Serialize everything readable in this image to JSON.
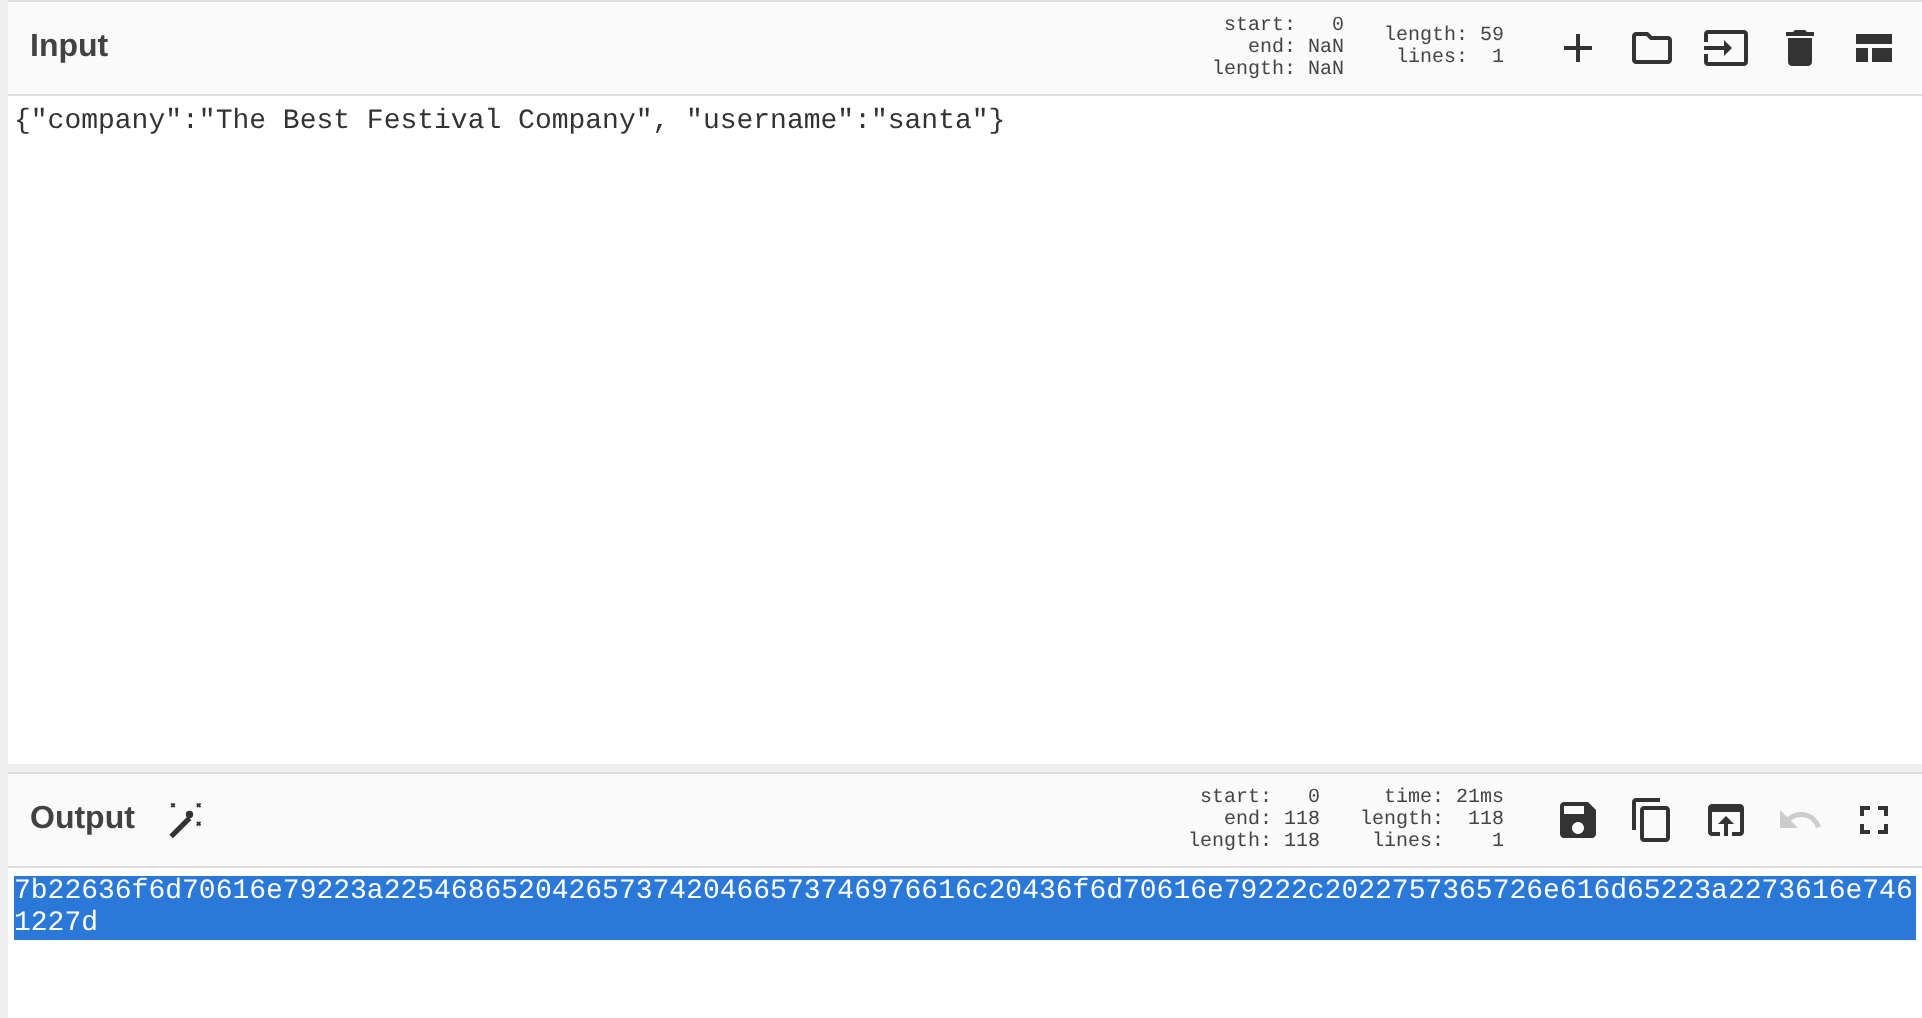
{
  "input": {
    "title": "Input",
    "stats": [
      {
        "label": "start:",
        "value": "0"
      },
      {
        "label": "end:",
        "value": "NaN"
      },
      {
        "label": "length:",
        "value": "NaN"
      }
    ],
    "stats_2": [
      {
        "label": "length:",
        "value": "59"
      },
      {
        "label": "lines:",
        "value": "1"
      }
    ],
    "tools": [
      {
        "kind": "add",
        "disabled": false
      },
      {
        "kind": "folder",
        "disabled": false
      },
      {
        "kind": "import",
        "disabled": false
      },
      {
        "kind": "delete",
        "disabled": false
      },
      {
        "kind": "layout",
        "disabled": false
      }
    ],
    "text": "{\"company\":\"The Best Festival Company\", \"username\":\"santa\"}"
  },
  "output": {
    "title": "Output",
    "stats": [
      {
        "label": "start:",
        "value": "0"
      },
      {
        "label": "end:",
        "value": "118"
      },
      {
        "label": "length:",
        "value": "118"
      }
    ],
    "stats_2": [
      {
        "label": "time:",
        "value": "21ms"
      },
      {
        "label": "length:",
        "value": "118"
      },
      {
        "label": "lines:",
        "value": "1"
      }
    ],
    "tools": [
      {
        "kind": "save",
        "disabled": false
      },
      {
        "kind": "copy",
        "disabled": false
      },
      {
        "kind": "replace",
        "disabled": false
      },
      {
        "kind": "undo",
        "disabled": true
      },
      {
        "kind": "maximise",
        "disabled": false
      }
    ],
    "text": "7b22636f6d70616e79223a22546865204265737420466573746976616c20436f6d70616e79222c2022757365726e616d65223a2273616e7461227d",
    "selected": true
  }
}
